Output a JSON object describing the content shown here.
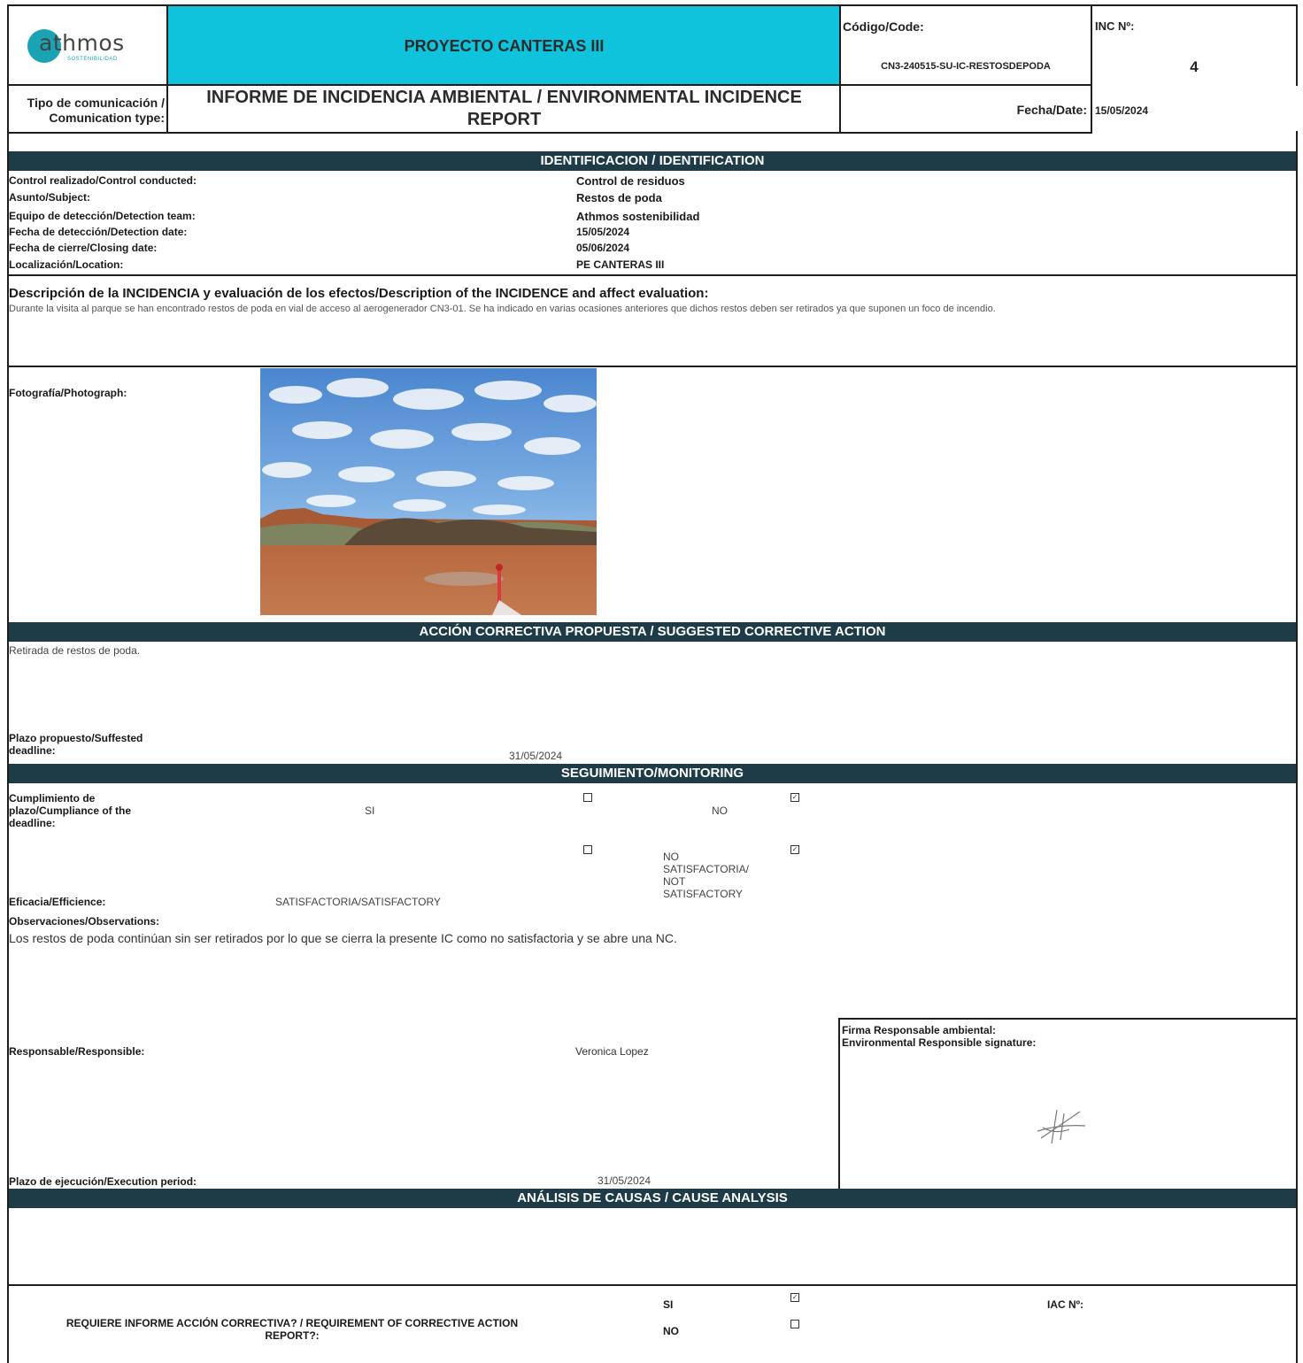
{
  "header": {
    "logo_text": "athmos",
    "logo_sub": "SOSTENIBILIDAD",
    "project": "PROYECTO CANTERAS III",
    "code_label": "Código/Code:",
    "code_value": "CN3-240515-SU-IC-RESTOSDEPODA",
    "inc_label": "INC Nº:",
    "inc_value": "4",
    "comm_type_label_1": "Tipo de comunicación /",
    "comm_type_label_2": "Comunication type:",
    "report_title_1": "INFORME DE INCIDENCIA AMBIENTAL / ENVIRONMENTAL INCIDENCE",
    "report_title_2": "REPORT",
    "date_label": "Fecha/Date:",
    "date_value": "15/05/2024"
  },
  "identification": {
    "heading": "IDENTIFICACION / IDENTIFICATION",
    "rows": [
      {
        "label": "Control realizado/Control conducted:",
        "value": "Control de  residuos"
      },
      {
        "label": "Asunto/Subject:",
        "value": "Restos de poda"
      },
      {
        "label": "Equipo de detección/Detection team:",
        "value": "Athmos sostenibilidad"
      },
      {
        "label": "Fecha de detección/Detection date:",
        "value": "15/05/2024"
      },
      {
        "label": "Fecha de cierre/Closing date:",
        "value": "05/06/2024"
      },
      {
        "label": "Localización/Location:",
        "value": "PE CANTERAS III"
      }
    ]
  },
  "description": {
    "heading": "Descripción de la INCIDENCIA y evaluación de los efectos/Description of the INCIDENCE and affect evaluation:",
    "text": "Durante la visita al parque se han encontrado restos de poda en vial de acceso al aerogenerador CN3-01. Se ha indicado en varias ocasiones anteriores que dichos restos deben ser retirados ya que suponen un foco de incendio."
  },
  "photo": {
    "label": "Fotografía/Photograph:"
  },
  "corrective": {
    "heading": "ACCIÓN CORRECTIVA PROPUESTA / SUGGESTED CORRECTIVE ACTION",
    "text": "Retirada de restos de poda.",
    "deadline_label_1": "Plazo propuesto/Suffested",
    "deadline_label_2": "deadline:",
    "deadline_value": "31/05/2024"
  },
  "monitoring": {
    "heading": "SEGUIMIENTO/MONITORING",
    "compliance_label_1": "Cumplimiento de",
    "compliance_label_2": "plazo/Cumpliance of the",
    "compliance_label_3": "deadline:",
    "si": "SI",
    "no": "NO",
    "efficiency_label": "Eficacia/Efficience:",
    "satisfactory": "SATISFACTORIA/SATISFACTORY",
    "not_sat_1": "NO",
    "not_sat_2": "SATISFACTORIA/",
    "not_sat_3": "NOT",
    "not_sat_4": "SATISFACTORY",
    "observations_label": "Observaciones/Observations:",
    "observations_text": "Los restos de poda continúan sin ser retirados por lo que se cierra la presente IC como no satisfactoria y se abre una NC.",
    "responsible_label": "Responsable/Responsible:",
    "responsible_value": "Veronica Lopez",
    "signature_label_1": "Firma Responsable ambiental:",
    "signature_label_2": "Environmental Responsible signature:",
    "execution_label": "Plazo de ejecución/Execution period:",
    "execution_value": "31/05/2024"
  },
  "cause": {
    "heading": "ANÁLISIS DE CAUSAS / CAUSE ANALYSIS",
    "requires_label_1": "REQUIERE INFORME ACCIÓN CORRECTIVA? / REQUIREMENT OF CORRECTIVE ACTION",
    "requires_label_2": "REPORT?:",
    "si": "SI",
    "no": "NO",
    "iac_label": "IAC Nº:"
  },
  "colors": {
    "band": "#1d3c48",
    "header_cyan": "#0fc3dc",
    "logo_teal": "#1aa3b3"
  }
}
